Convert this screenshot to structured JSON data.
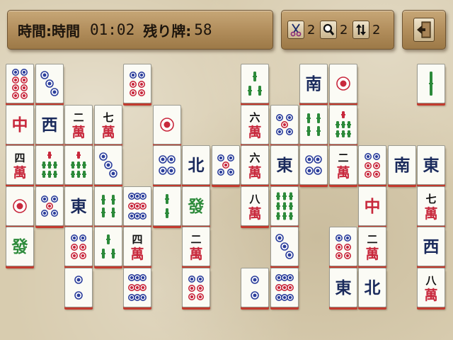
{
  "status": {
    "time_label_1": "時間",
    "time_label_2": ":時間",
    "time_value": "01:02",
    "remaining_label": "残り牌:",
    "remaining_value": "58"
  },
  "tools": [
    {
      "icon": "scissors-icon",
      "count": "2"
    },
    {
      "icon": "magnifier-icon",
      "count": "2"
    },
    {
      "icon": "shuffle-arrows-icon",
      "count": "2"
    }
  ],
  "exit_icon": "exit-door-icon",
  "colors": {
    "tile_face": "#fbfbf5",
    "tile_edge": "#c23a2e",
    "panel_wood": "#b08c5a"
  },
  "tiles": [
    {
      "col": 0,
      "row": 0,
      "face": "p8"
    },
    {
      "col": 1,
      "row": 0,
      "face": "p3"
    },
    {
      "col": 4,
      "row": 0,
      "face": "p6"
    },
    {
      "col": 8,
      "row": 0,
      "face": "b3"
    },
    {
      "col": 10,
      "row": 0,
      "face": "S"
    },
    {
      "col": 11,
      "row": 0,
      "face": "p1"
    },
    {
      "col": 14,
      "row": 0,
      "face": "b1"
    },
    {
      "col": 0,
      "row": 1,
      "face": "C"
    },
    {
      "col": 1,
      "row": 1,
      "face": "W"
    },
    {
      "col": 2,
      "row": 1,
      "face": "m2"
    },
    {
      "col": 3,
      "row": 1,
      "face": "m7"
    },
    {
      "col": 5,
      "row": 1,
      "face": "p1"
    },
    {
      "col": 8,
      "row": 1,
      "face": "m6"
    },
    {
      "col": 9,
      "row": 1,
      "face": "p5"
    },
    {
      "col": 10,
      "row": 1,
      "face": "b6"
    },
    {
      "col": 11,
      "row": 1,
      "face": "b7"
    },
    {
      "col": 0,
      "row": 2,
      "face": "m4"
    },
    {
      "col": 1,
      "row": 2,
      "face": "b7"
    },
    {
      "col": 2,
      "row": 2,
      "face": "b7"
    },
    {
      "col": 3,
      "row": 2,
      "face": "p3"
    },
    {
      "col": 5,
      "row": 2,
      "face": "p4"
    },
    {
      "col": 6,
      "row": 2,
      "face": "N"
    },
    {
      "col": 7,
      "row": 2,
      "face": "p5"
    },
    {
      "col": 8,
      "row": 2,
      "face": "m6"
    },
    {
      "col": 9,
      "row": 2,
      "face": "E"
    },
    {
      "col": 10,
      "row": 2,
      "face": "p4"
    },
    {
      "col": 11,
      "row": 2,
      "face": "m2"
    },
    {
      "col": 12,
      "row": 2,
      "face": "p6"
    },
    {
      "col": 13,
      "row": 2,
      "face": "S"
    },
    {
      "col": 14,
      "row": 2,
      "face": "E"
    },
    {
      "col": 0,
      "row": 3,
      "face": "p1"
    },
    {
      "col": 1,
      "row": 3,
      "face": "p5"
    },
    {
      "col": 2,
      "row": 3,
      "face": "E"
    },
    {
      "col": 3,
      "row": 3,
      "face": "b6"
    },
    {
      "col": 4,
      "row": 3,
      "face": "p9"
    },
    {
      "col": 5,
      "row": 3,
      "face": "b2"
    },
    {
      "col": 6,
      "row": 3,
      "face": "F"
    },
    {
      "col": 8,
      "row": 3,
      "face": "m8"
    },
    {
      "col": 9,
      "row": 3,
      "face": "b9"
    },
    {
      "col": 12,
      "row": 3,
      "face": "C"
    },
    {
      "col": 14,
      "row": 3,
      "face": "m7"
    },
    {
      "col": 0,
      "row": 4,
      "face": "F"
    },
    {
      "col": 2,
      "row": 4,
      "face": "p6"
    },
    {
      "col": 3,
      "row": 4,
      "face": "b3"
    },
    {
      "col": 4,
      "row": 4,
      "face": "m4"
    },
    {
      "col": 6,
      "row": 4,
      "face": "m2"
    },
    {
      "col": 9,
      "row": 4,
      "face": "p3"
    },
    {
      "col": 11,
      "row": 4,
      "face": "p6"
    },
    {
      "col": 12,
      "row": 4,
      "face": "m2"
    },
    {
      "col": 14,
      "row": 4,
      "face": "W"
    },
    {
      "col": 2,
      "row": 5,
      "face": "p2"
    },
    {
      "col": 4,
      "row": 5,
      "face": "p9"
    },
    {
      "col": 6,
      "row": 5,
      "face": "p6"
    },
    {
      "col": 8,
      "row": 5,
      "face": "p2"
    },
    {
      "col": 9,
      "row": 5,
      "face": "p9"
    },
    {
      "col": 11,
      "row": 5,
      "face": "E"
    },
    {
      "col": 12,
      "row": 5,
      "face": "N"
    },
    {
      "col": 14,
      "row": 5,
      "face": "m8"
    }
  ]
}
